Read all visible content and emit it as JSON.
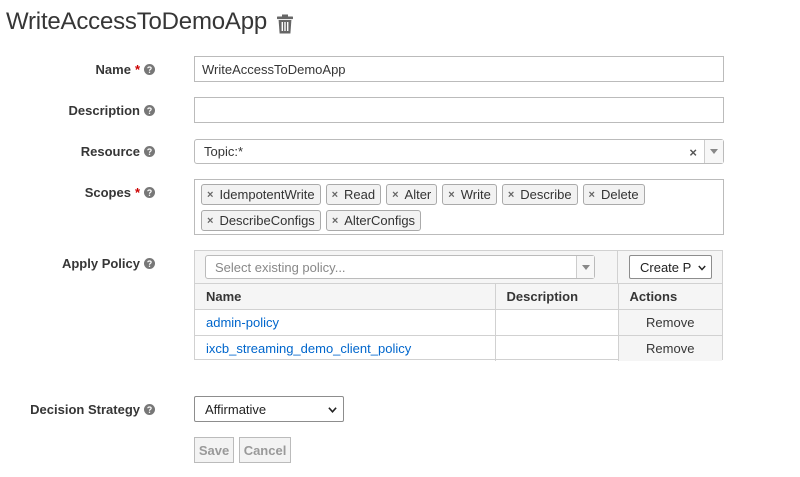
{
  "header": {
    "title": "WriteAccessToDemoApp",
    "delete_icon": "trash-icon"
  },
  "fields": {
    "name": {
      "label": "Name",
      "required": "*",
      "value": "WriteAccessToDemoApp"
    },
    "description": {
      "label": "Description",
      "value": ""
    },
    "resource": {
      "label": "Resource",
      "value": "Topic:*",
      "clear": "×"
    },
    "scopes": {
      "label": "Scopes",
      "required": "*",
      "items": [
        "IdempotentWrite",
        "Read",
        "Alter",
        "Write",
        "Describe",
        "Delete",
        "DescribeConfigs",
        "AlterConfigs"
      ],
      "remove_glyph": "×"
    },
    "apply_policy": {
      "label": "Apply Policy",
      "placeholder": "Select existing policy...",
      "create_select": "Create P",
      "columns": [
        "Name",
        "Description",
        "Actions"
      ],
      "rows": [
        {
          "name": "admin-policy",
          "description": "",
          "action": "Remove"
        },
        {
          "name": "ixcb_streaming_demo_client_policy",
          "description": "",
          "action": "Remove"
        }
      ]
    },
    "decision_strategy": {
      "label": "Decision Strategy",
      "value": "Affirmative"
    }
  },
  "buttons": {
    "save": "Save",
    "cancel": "Cancel"
  },
  "colors": {
    "link": "#0066cc",
    "required": "#cc0000",
    "text": "#363636",
    "border": "#bbbbbb"
  }
}
